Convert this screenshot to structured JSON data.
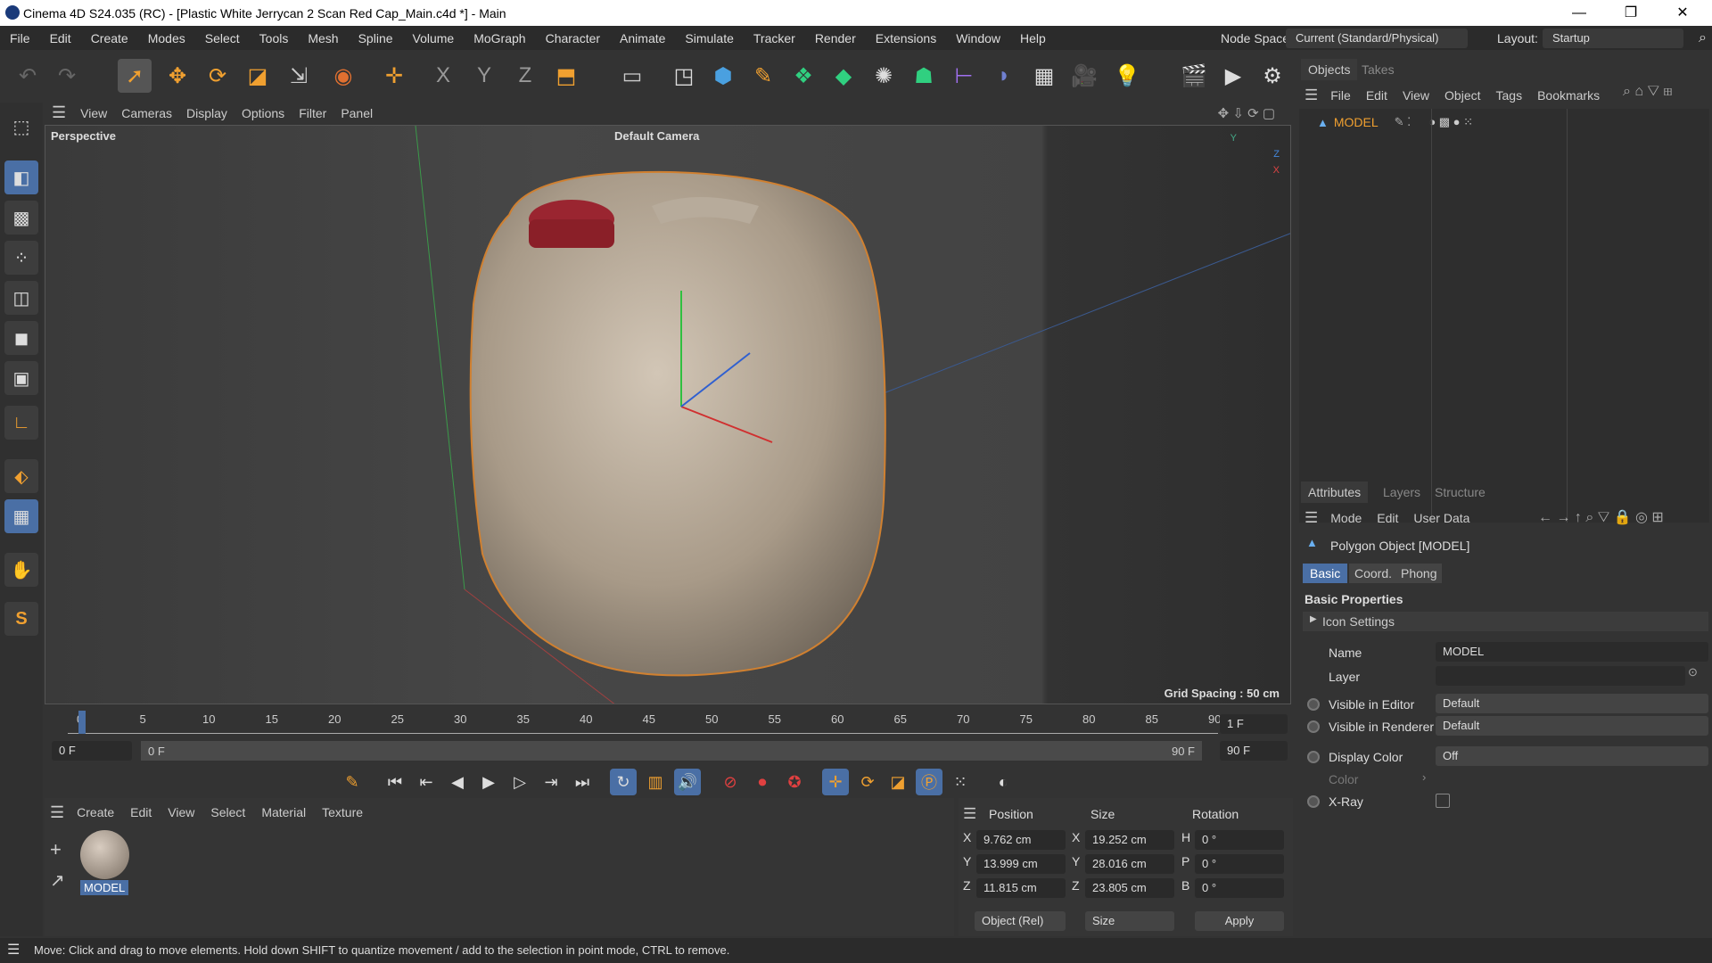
{
  "title": "Cinema 4D S24.035 (RC) - [Plastic White Jerrycan 2 Scan Red Cap_Main.c4d *] - Main",
  "window_controls": [
    "—",
    "❐",
    "✕"
  ],
  "menu": [
    "File",
    "Edit",
    "Create",
    "Modes",
    "Select",
    "Tools",
    "Mesh",
    "Spline",
    "Volume",
    "MoGraph",
    "Character",
    "Animate",
    "Simulate",
    "Tracker",
    "Render",
    "Extensions",
    "Window",
    "Help"
  ],
  "node_space": {
    "label": "Node Space:",
    "value": "Current (Standard/Physical)"
  },
  "layout": {
    "label": "Layout:",
    "value": "Startup"
  },
  "viewport": {
    "menu": [
      "View",
      "Cameras",
      "Display",
      "Options",
      "Filter",
      "Panel"
    ],
    "name": "Perspective",
    "camera": "Default Camera",
    "grid": "Grid Spacing : 50 cm",
    "axes": [
      "Y",
      "Z",
      "X"
    ]
  },
  "timeline": {
    "ticks": [
      "0",
      "5",
      "10",
      "15",
      "20",
      "25",
      "30",
      "35",
      "40",
      "45",
      "50",
      "55",
      "60",
      "65",
      "70",
      "75",
      "80",
      "85",
      "90"
    ],
    "current_frame": "1 F",
    "start": "0 F",
    "range_start": "0 F",
    "range_end": "90 F",
    "end": "90 F"
  },
  "material_manager": {
    "menu": [
      "Create",
      "Edit",
      "View",
      "Select",
      "Material",
      "Texture"
    ],
    "materials": [
      {
        "name": "MODEL"
      }
    ]
  },
  "coordinates": {
    "headers": [
      "Position",
      "Size",
      "Rotation"
    ],
    "rows": [
      {
        "axis": "X",
        "pos": "9.762 cm",
        "saxis": "X",
        "size": "19.252 cm",
        "raxis": "H",
        "rot": "0 °"
      },
      {
        "axis": "Y",
        "pos": "13.999 cm",
        "saxis": "Y",
        "size": "28.016 cm",
        "raxis": "P",
        "rot": "0 °"
      },
      {
        "axis": "Z",
        "pos": "11.815 cm",
        "saxis": "Z",
        "size": "23.805 cm",
        "raxis": "B",
        "rot": "0 °"
      }
    ],
    "mode": "Object (Rel)",
    "size_mode": "Size",
    "apply": "Apply"
  },
  "status": "Move: Click and drag to move elements. Hold down SHIFT to quantize movement / add to the selection in point mode, CTRL to remove.",
  "objects_panel": {
    "tabs": [
      "Objects",
      "Takes"
    ],
    "menu": [
      "File",
      "Edit",
      "View",
      "Object",
      "Tags",
      "Bookmarks"
    ],
    "items": [
      {
        "name": "MODEL"
      }
    ]
  },
  "attributes": {
    "tabs": [
      "Attributes",
      "Layers",
      "Structure"
    ],
    "menu": [
      "Mode",
      "Edit",
      "User Data"
    ],
    "object": "Polygon Object [MODEL]",
    "subtabs": [
      "Basic",
      "Coord.",
      "Phong"
    ],
    "section": "Basic Properties",
    "group": "Icon Settings",
    "fields": {
      "name_label": "Name",
      "name": "MODEL",
      "layer_label": "Layer",
      "layer": "",
      "vis_editor_label": "Visible in Editor",
      "vis_editor": "Default",
      "vis_render_label": "Visible in Renderer",
      "vis_render": "Default",
      "display_color_label": "Display Color",
      "display_color": "Off",
      "color_label": "Color",
      "xray_label": "X-Ray"
    }
  },
  "colors": {
    "accent": "#4a6fa5",
    "selection": "#e8a040"
  }
}
